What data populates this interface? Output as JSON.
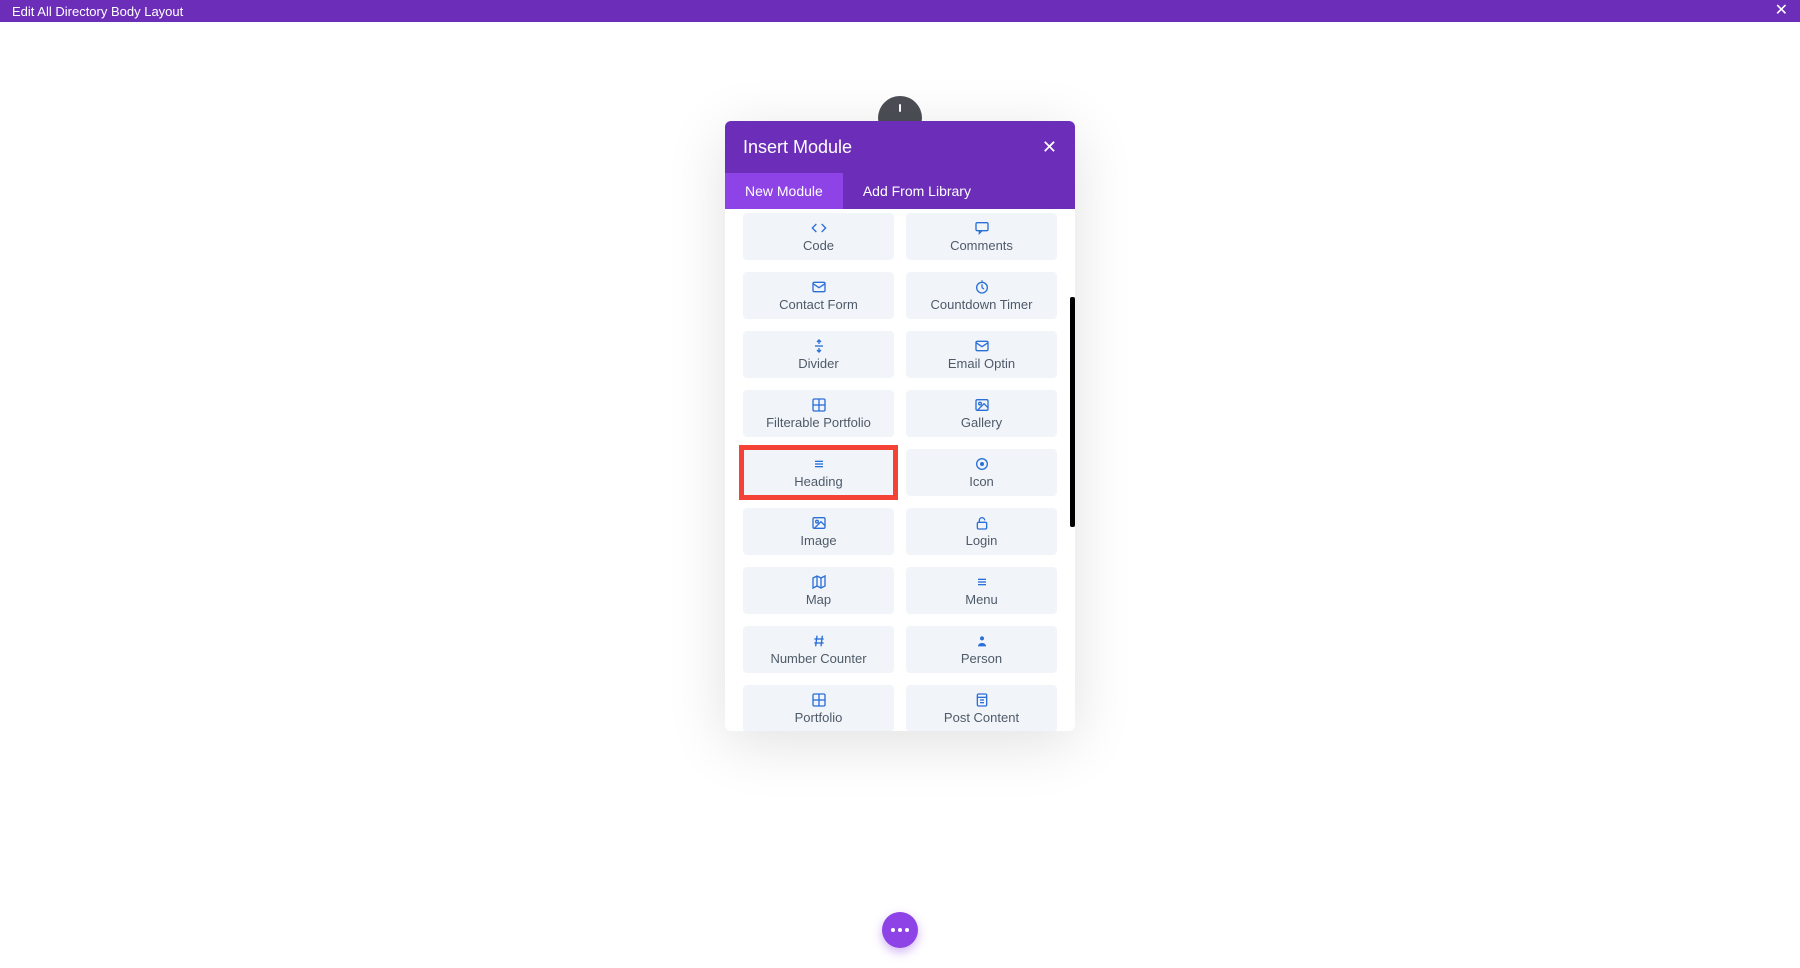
{
  "topbar": {
    "title": "Edit All Directory Body Layout"
  },
  "modal": {
    "title": "Insert Module",
    "tabs": {
      "new": "New Module",
      "library": "Add From Library"
    }
  },
  "modules": [
    {
      "id": "code",
      "label": "Code",
      "icon": "code"
    },
    {
      "id": "comments",
      "label": "Comments",
      "icon": "chat"
    },
    {
      "id": "contact-form",
      "label": "Contact Form",
      "icon": "mail"
    },
    {
      "id": "countdown-timer",
      "label": "Countdown Timer",
      "icon": "clock"
    },
    {
      "id": "divider",
      "label": "Divider",
      "icon": "divider"
    },
    {
      "id": "email-optin",
      "label": "Email Optin",
      "icon": "mail"
    },
    {
      "id": "filterable-portfolio",
      "label": "Filterable Portfolio",
      "icon": "grid"
    },
    {
      "id": "gallery",
      "label": "Gallery",
      "icon": "image"
    },
    {
      "id": "heading",
      "label": "Heading",
      "icon": "lines",
      "highlight": true
    },
    {
      "id": "icon",
      "label": "Icon",
      "icon": "target"
    },
    {
      "id": "image",
      "label": "Image",
      "icon": "image"
    },
    {
      "id": "login",
      "label": "Login",
      "icon": "lock"
    },
    {
      "id": "map",
      "label": "Map",
      "icon": "map"
    },
    {
      "id": "menu",
      "label": "Menu",
      "icon": "lines"
    },
    {
      "id": "number-counter",
      "label": "Number Counter",
      "icon": "hash"
    },
    {
      "id": "person",
      "label": "Person",
      "icon": "person"
    },
    {
      "id": "portfolio",
      "label": "Portfolio",
      "icon": "grid"
    },
    {
      "id": "post-content",
      "label": "Post Content",
      "icon": "doc"
    }
  ]
}
